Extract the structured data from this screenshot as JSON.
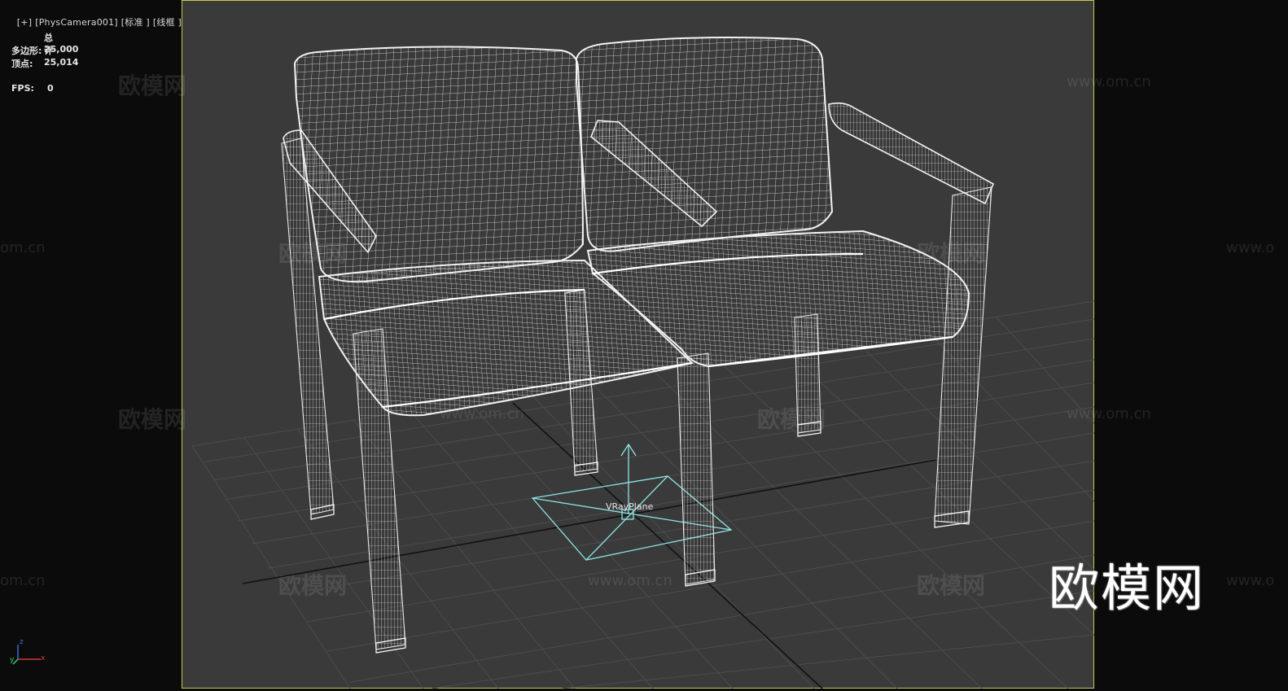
{
  "viewport": {
    "label_parts": [
      "[+]",
      "[PhysCamera001]",
      "[标准 ]",
      "[线框 ]"
    ],
    "frame_color": "#c9c94a",
    "background": "#3a3a3a"
  },
  "stats": {
    "header": "总计",
    "polygons_label": "多边形:",
    "polygons_value": "25,000",
    "vertices_label": "顶点:",
    "vertices_value": "25,014",
    "fps_label": "FPS:",
    "fps_value": "0"
  },
  "scene": {
    "object_label": "VRayPlane",
    "wire_color": "#e8e8e8",
    "plane_color": "#8fe3e3"
  },
  "watermarks": {
    "cn_text": "欧模网",
    "url_text": "www.om.cn",
    "short_url": "om.cn",
    "url_prefix": "www.o"
  },
  "logo": {
    "text": "欧模网"
  },
  "axis": {
    "x": "x",
    "y": "y",
    "z": "z"
  }
}
